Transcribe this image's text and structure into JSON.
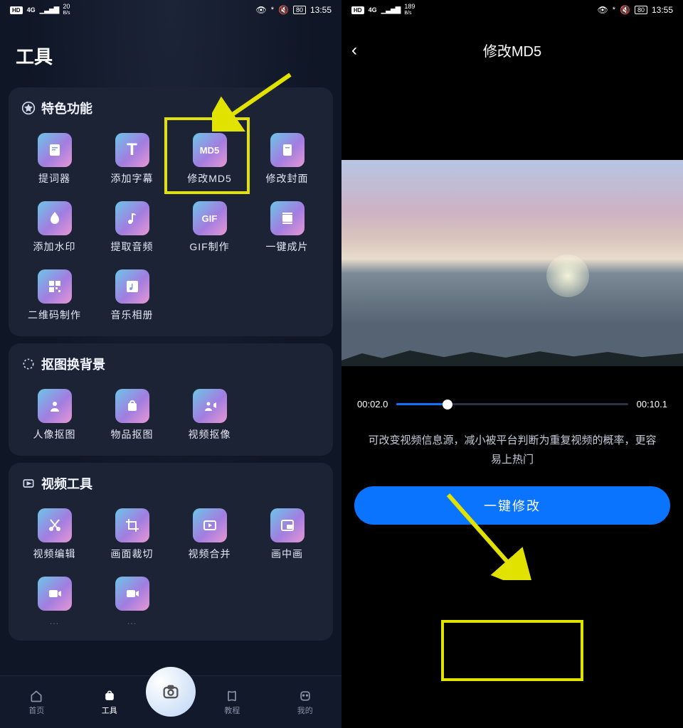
{
  "status": {
    "hd": "HD",
    "net": "4G",
    "speed_left": "20",
    "speed_unit": "B/s",
    "speed_right": "189",
    "battery": "80",
    "time": "13:55"
  },
  "left": {
    "title": "工具",
    "section1": {
      "title": "特色功能",
      "items": [
        {
          "label": "提词器",
          "icon": "doc"
        },
        {
          "label": "添加字幕",
          "icon": "T"
        },
        {
          "label": "修改MD5",
          "icon": "MD5"
        },
        {
          "label": "修改封面",
          "icon": "page"
        },
        {
          "label": "添加水印",
          "icon": "drop"
        },
        {
          "label": "提取音频",
          "icon": "note"
        },
        {
          "label": "GIF制作",
          "icon": "GIF"
        },
        {
          "label": "一键成片",
          "icon": "film"
        },
        {
          "label": "二维码制作",
          "icon": "qr"
        },
        {
          "label": "音乐相册",
          "icon": "music"
        }
      ]
    },
    "section2": {
      "title": "抠图换背景",
      "items": [
        {
          "label": "人像抠图",
          "icon": "person"
        },
        {
          "label": "物品抠图",
          "icon": "bag"
        },
        {
          "label": "视频抠像",
          "icon": "vidperson"
        }
      ]
    },
    "section3": {
      "title": "视频工具",
      "items": [
        {
          "label": "视频编辑",
          "icon": "cut"
        },
        {
          "label": "画面裁切",
          "icon": "crop"
        },
        {
          "label": "视频合并",
          "icon": "play"
        },
        {
          "label": "画中画",
          "icon": "pip"
        }
      ]
    },
    "nav": {
      "home": "首页",
      "tools": "工具",
      "tutorial": "教程",
      "mine": "我的"
    }
  },
  "right": {
    "title": "修改MD5",
    "time_current": "00:02.0",
    "time_total": "00:10.1",
    "hint": "可改变视频信息源，减小被平台判断为重复视频的概率，更容易上热门",
    "button": "一键修改"
  }
}
